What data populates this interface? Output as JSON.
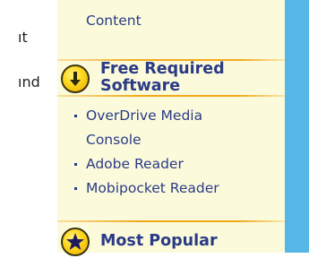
{
  "left_column": {
    "fragment_1": "ıt",
    "fragment_2": "ınd"
  },
  "sidebar": {
    "content_link": "Content",
    "free_software": {
      "title_line_1": "Free Required",
      "title_line_2": "Software",
      "icon": "download-arrow-icon",
      "items": [
        {
          "line_1": "OverDrive Media",
          "line_2": "Console"
        },
        {
          "line_1": "Adobe Reader"
        },
        {
          "line_1": "Mobipocket Reader"
        }
      ]
    },
    "most_popular": {
      "title": "Most Popular",
      "icon": "star-icon"
    }
  },
  "colors": {
    "panel_bg": "#fbfbdc",
    "link": "#2b3a85",
    "accent_rule": "#f2a81c",
    "right_strip": "#56b7e6",
    "icon_fill": "#ffd61c"
  }
}
